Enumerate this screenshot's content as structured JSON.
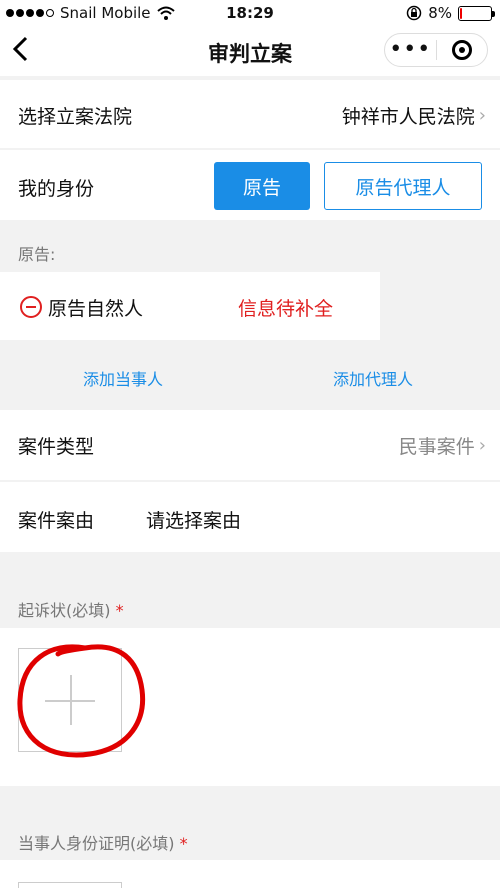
{
  "status_bar": {
    "carrier": "Snail Mobile",
    "time": "18:29",
    "battery_percent": "8%",
    "battery_level": 0.08
  },
  "nav": {
    "title": "审判立案",
    "more_icon": "more-dots-icon",
    "close_icon": "target-circle-icon"
  },
  "form": {
    "court_label": "选择立案法院",
    "court_value": "钟祥市人民法院",
    "identity_label": "我的身份",
    "identity_options": [
      "原告",
      "原告代理人"
    ],
    "plaintiff_section": "原告:",
    "party_name": "原告自然人",
    "party_status": "信息待补全",
    "add_party": "添加当事人",
    "add_agent": "添加代理人",
    "case_type_label": "案件类型",
    "case_type_value": "民事案件",
    "case_cause_label": "案件案由",
    "case_cause_placeholder": "请选择案由",
    "complaint_label": "起诉状(必填)",
    "required_mark": "*",
    "id_proof_label": "当事人身份证明(必填)"
  },
  "colors": {
    "primary": "#1a8de6",
    "danger": "#e02020",
    "annotation": "#e00000"
  }
}
